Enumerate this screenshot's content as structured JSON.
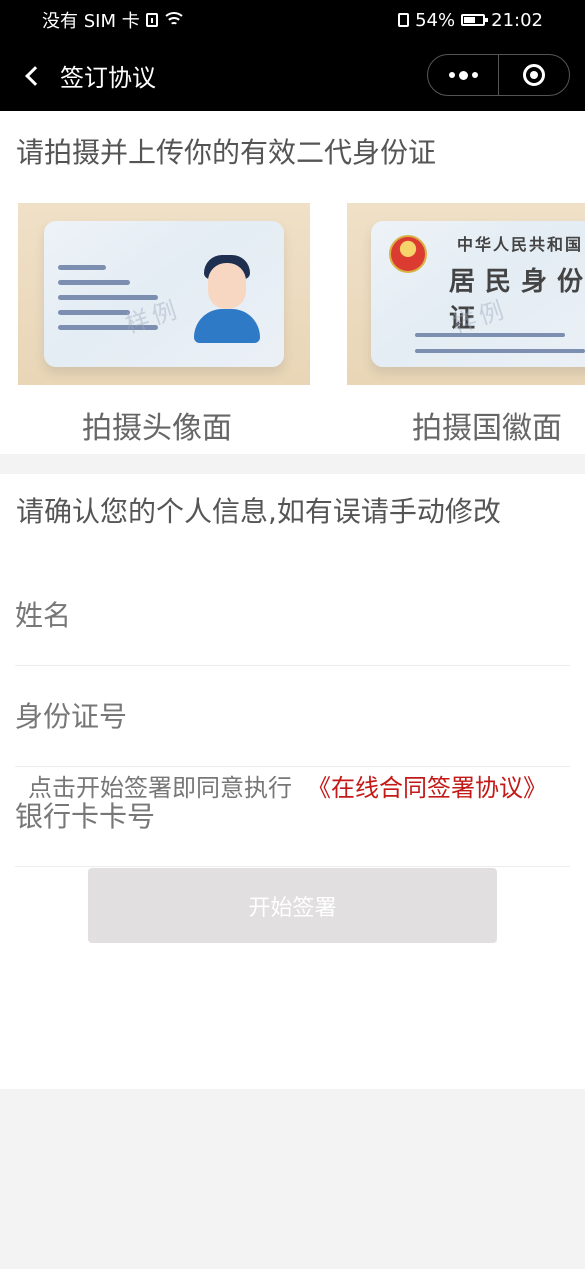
{
  "status_bar": {
    "carrier": "没有 SIM 卡",
    "battery_percent": "54%",
    "battery_level": 0.54,
    "time": "21:02"
  },
  "nav": {
    "title": "签订协议"
  },
  "upload": {
    "title": "请拍摄并上传你的有效二代身份证",
    "front_label": "拍摄头像面",
    "back_label": "拍摄国徽面"
  },
  "info": {
    "title": "请确认您的个人信息,如有误请手动修改",
    "name_placeholder": "姓名",
    "id_placeholder": "身份证号",
    "bank_placeholder": "银行卡卡号"
  },
  "agreement": {
    "prefix": "点击开始签署即同意执行",
    "link_text": "《在线合同签署协议》"
  },
  "actions": {
    "start_sign": "开始签署"
  },
  "colors": {
    "nav_bg": "#000000",
    "page_bg": "#f3f3f3",
    "link": "#c31a17",
    "button_bg": "#e1dfdf",
    "face_hair": "#1f2f4f",
    "face_body": "#2e7ac6"
  },
  "icons": {
    "sim": "sim-card-icon",
    "wifi": "wifi-icon",
    "vibrate": "vibrate-icon",
    "battery": "battery-icon",
    "back": "chevron-left-icon",
    "menu": "more-dots-icon",
    "close": "target-icon",
    "avatar": "person-avatar-icon",
    "emblem": "national-emblem-icon"
  }
}
